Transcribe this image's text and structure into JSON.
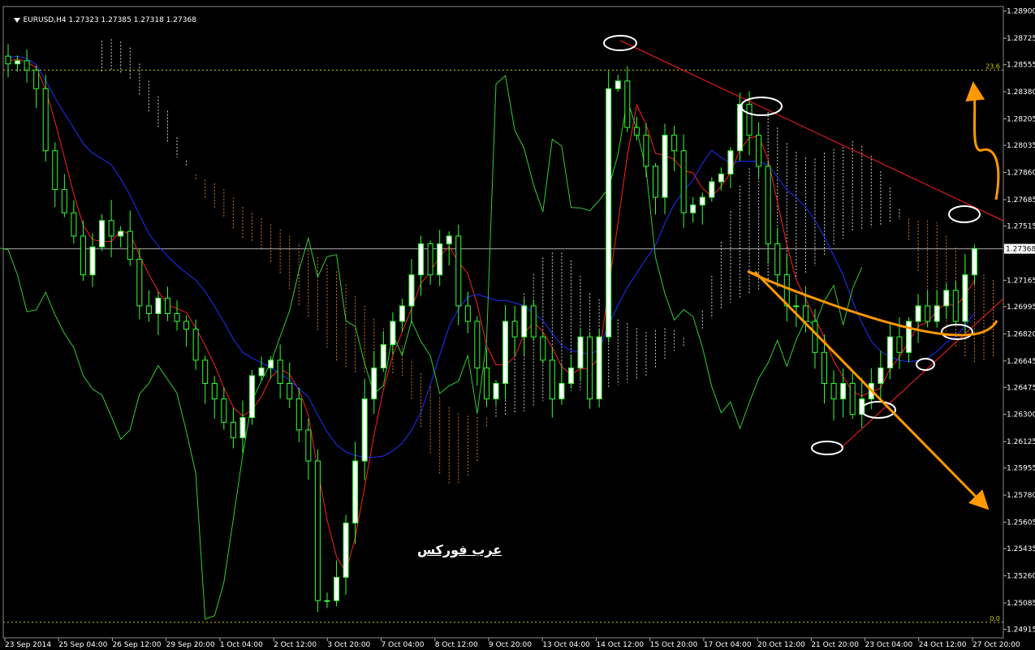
{
  "header": {
    "symbol": "EURUSD,H4",
    "ohlc": "1.27323 1.27385 1.27318 1.27368"
  },
  "watermark": "عرب فوركس",
  "colors": {
    "background": "#000000",
    "candle": "#ffffff",
    "candle_outline": "#33ff33",
    "tenkan": "#ff2020",
    "kijun": "#2030ff",
    "chikou": "#33cc33",
    "cloud_a": "#ffffff",
    "cloud_b": "#ff9933",
    "trendline": "#ff2020",
    "arrow": "#ff9900",
    "fib": "#cccc00",
    "current_price_line": "#aaaaaa"
  },
  "chart_data": {
    "type": "candlestick",
    "instrument": "EURUSD",
    "timeframe": "H4",
    "ylim": [
      1.2486,
      1.2893
    ],
    "y_ticks": [
      "1.28900",
      "1.28725",
      "1.28555",
      "1.28380",
      "1.28205",
      "1.28035",
      "1.27860",
      "1.27685",
      "1.27515",
      "1.27368",
      "1.27165",
      "1.26995",
      "1.26820",
      "1.26645",
      "1.26475",
      "1.26300",
      "1.26125",
      "1.25955",
      "1.25780",
      "1.25605",
      "1.25435",
      "1.25260",
      "1.25085",
      "1.24915"
    ],
    "x_ticks": [
      "23 Sep 2014",
      "25 Sep 04:00",
      "26 Sep 12:00",
      "29 Sep 20:00",
      "1 Oct 04:00",
      "2 Oct 12:00",
      "3 Oct 20:00",
      "7 Oct 04:00",
      "8 Oct 12:00",
      "9 Oct 20:00",
      "13 Oct 04:00",
      "14 Oct 12:00",
      "15 Oct 20:00",
      "17 Oct 04:00",
      "20 Oct 12:00",
      "21 Oct 20:00",
      "23 Oct 04:00",
      "24 Oct 12:00",
      "27 Oct 20:00"
    ],
    "current_price": 1.27368,
    "fib_levels": [
      {
        "label": "23.6",
        "price": 1.2852
      },
      {
        "label": "0.0",
        "price": 1.2496
      }
    ],
    "close_path": [
      1.2856,
      1.2858,
      1.2852,
      1.284,
      1.28,
      1.2775,
      1.276,
      1.2745,
      1.272,
      1.2738,
      1.2755,
      1.2745,
      1.2748,
      1.273,
      1.27,
      1.2695,
      1.2705,
      1.2695,
      1.269,
      1.2685,
      1.2665,
      1.265,
      1.264,
      1.2625,
      1.2615,
      1.2628,
      1.2655,
      1.266,
      1.2665,
      1.265,
      1.264,
      1.262,
      1.26,
      1.251,
      1.251,
      1.2525,
      1.256,
      1.26,
      1.264,
      1.266,
      1.2675,
      1.269,
      1.27,
      1.272,
      1.274,
      1.272,
      1.274,
      1.2745,
      1.27,
      1.269,
      1.266,
      1.264,
      1.265,
      1.269,
      1.268,
      1.27,
      1.268,
      1.2665,
      1.264,
      1.265,
      1.266,
      1.268,
      1.264,
      1.268,
      1.284,
      1.2845,
      1.2815,
      1.281,
      1.279,
      1.277,
      1.281,
      1.28,
      1.276,
      1.2765,
      1.277,
      1.278,
      1.2785,
      1.28,
      1.283,
      1.281,
      1.279,
      1.274,
      1.272,
      1.27,
      1.27,
      1.269,
      1.267,
      1.265,
      1.264,
      1.265,
      1.263,
      1.264,
      1.265,
      1.266,
      1.268,
      1.267,
      1.269,
      1.27,
      1.269,
      1.27,
      1.271,
      1.269,
      1.272,
      1.2737
    ]
  }
}
